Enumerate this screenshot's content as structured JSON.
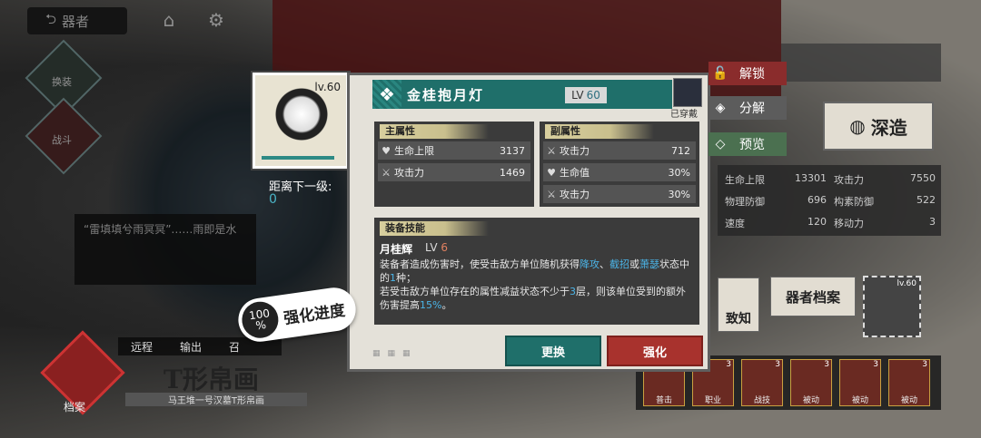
{
  "nav": {
    "back_label": "器者",
    "side_buttons": [
      "换装",
      "战斗"
    ]
  },
  "background": {
    "quote": "“雷填填兮雨冥冥”……雨即是水",
    "tabs": [
      "远程",
      "输出",
      "召"
    ],
    "title": "T形帛画",
    "subtitle": "马王堆一号汉墓T形帛画",
    "emblem_label": "档案"
  },
  "progress_badge": {
    "percent": "100",
    "unit": "%",
    "label": "强化进度"
  },
  "item_card": {
    "level": "lv.60"
  },
  "next_level": {
    "label": "距离下一级:",
    "value": "0"
  },
  "panel": {
    "name": "金桂抱月灯",
    "lv_label": "LV",
    "lv_value": "60",
    "equipped_label": "已穿戴",
    "main_stats": {
      "title": "主属性",
      "rows": [
        {
          "icon": "heart-icon",
          "name": "生命上限",
          "value": "3137"
        },
        {
          "icon": "swords-icon",
          "name": "攻击力",
          "value": "1469"
        }
      ]
    },
    "sub_stats": {
      "title": "副属性",
      "rows": [
        {
          "icon": "swords-icon",
          "name": "攻击力",
          "value": "712"
        },
        {
          "icon": "heart-icon",
          "name": "生命值",
          "value": "30%"
        },
        {
          "icon": "swords-icon",
          "name": "攻击力",
          "value": "30%"
        }
      ]
    },
    "skill": {
      "title": "装备技能",
      "name": "月桂辉",
      "lv_label": "LV",
      "lv_value": "6",
      "desc_1": "装备者造成伤害时，使受击敌方单位随机获得",
      "hl_1": "降攻",
      "sep_1": "、",
      "hl_2": "截招",
      "desc_2": "或",
      "hl_3": "萧瑟",
      "desc_3": "状态中的",
      "hl_4": "1",
      "desc_4": "种；",
      "desc_5": "若受击敌方单位存在的属性减益状态不少于",
      "hl_5": "3",
      "desc_6": "层，则该单位受到的额外伤害提高",
      "hl_6": "15%",
      "desc_7": "。"
    },
    "buttons": {
      "replace": "更换",
      "enhance": "强化"
    }
  },
  "right_tags": {
    "unlock": "解锁",
    "split": "分解",
    "preview": "预览"
  },
  "right_panel": {
    "deep_label": "深造",
    "stats": [
      {
        "name": "生命上限",
        "value": "13301"
      },
      {
        "name": "攻击力",
        "value": "7550"
      },
      {
        "name": "物理防御",
        "value": "696"
      },
      {
        "name": "构素防御",
        "value": "522"
      },
      {
        "name": "速度",
        "value": "120"
      },
      {
        "name": "移动力",
        "value": "3"
      }
    ],
    "archive_label": "器者档案",
    "zhizhi_label": "致知",
    "thumb_level": "lv.60",
    "skills": [
      {
        "label": "普击",
        "count": "3"
      },
      {
        "label": "职业",
        "count": "3"
      },
      {
        "label": "战技",
        "count": "3"
      },
      {
        "label": "被动",
        "count": "3"
      },
      {
        "label": "被动",
        "count": "3"
      },
      {
        "label": "被动",
        "count": "3"
      }
    ]
  }
}
